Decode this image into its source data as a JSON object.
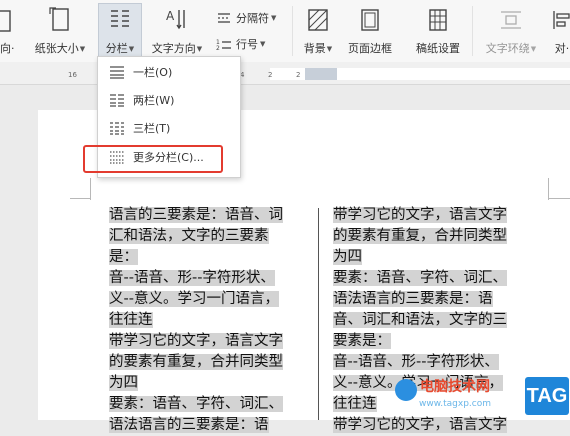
{
  "ribbon": {
    "orientation_partial": "向·",
    "paper_size": "纸张大小",
    "columns": "分栏",
    "text_direction": "文字方向",
    "separator": "分隔符",
    "line_number": "行号",
    "background": "背景",
    "page_border": "页面边框",
    "manuscript": "稿纸设置",
    "text_wrap": "文字环绕",
    "align_partial": "对·"
  },
  "ruler": {
    "marks": [
      "16",
      "14",
      "12",
      "10",
      "8",
      "6",
      "4",
      "2",
      "2"
    ]
  },
  "menu": {
    "items": [
      "一栏(O)",
      "两栏(W)",
      "三栏(T)",
      "更多分栏(C)..."
    ]
  },
  "document": {
    "left_column": [
      "语言的三要素是：语音、词",
      "汇和语法，文字的三要素",
      "是：",
      "音--语音、形--字符形状、",
      "义--意义。学习一门语言，",
      "往往连",
      "带学习它的文字，语言文字",
      "的要素有重复，合并同类型",
      "为四",
      "要素：语音、字符、词汇、",
      "语法语言的三要素是：语"
    ],
    "right_column": [
      "带学习它的文字，语言文字",
      "的要素有重复，合并同类型",
      "为四",
      "要素：语音、字符、词汇、",
      "语法语言的三要素是：语",
      "音、词汇和语法，文字的三",
      "要素是：",
      "音--语音、形--字符形状、",
      "义--意义。学习一门语言，",
      "往往连",
      "带学习它的文字，语言文字"
    ]
  },
  "watermark": {
    "site_name": "电脑技术网",
    "url": "www.tagxp.com",
    "tag": "TAG"
  },
  "colors": {
    "highlight_border": "#e33b2f",
    "text_selection": "#d3d3d3",
    "watermark_blue": "#1f86d9"
  }
}
